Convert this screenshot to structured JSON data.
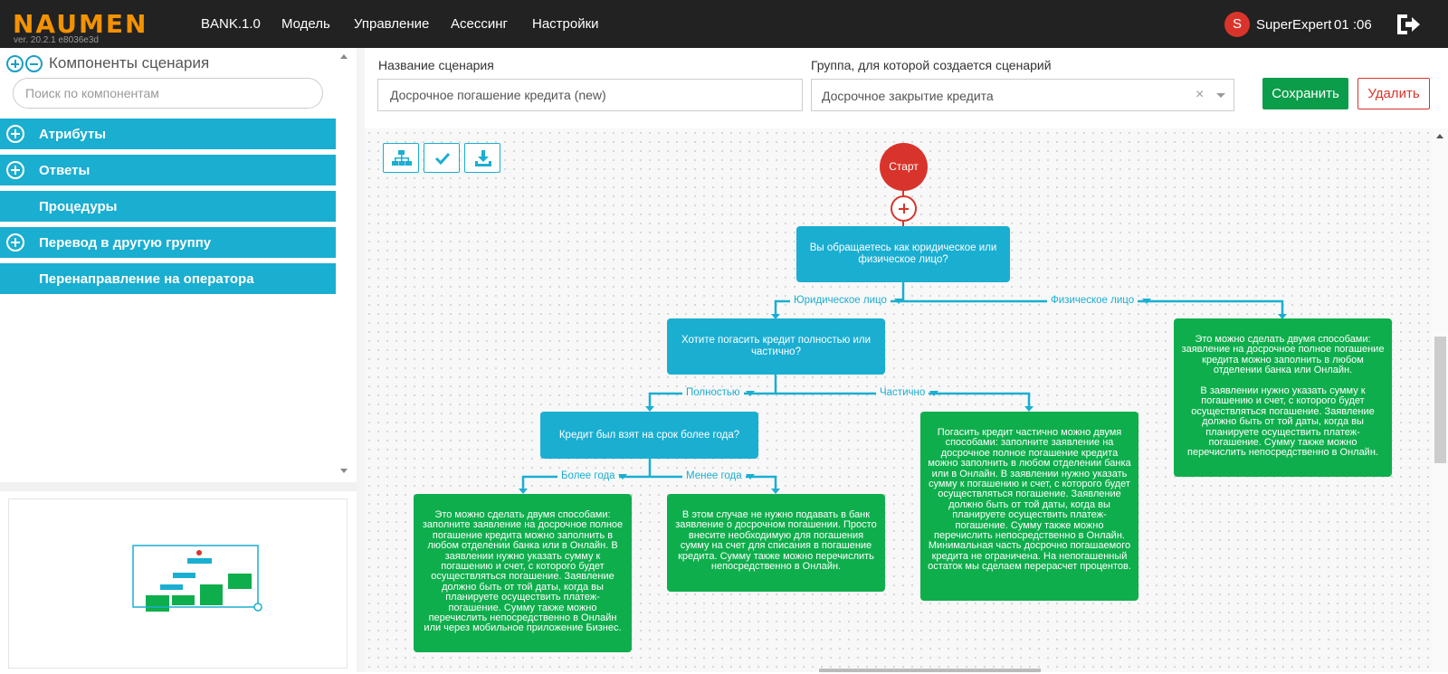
{
  "header": {
    "logo": "NAUMEN",
    "version": "ver. 20.2.1 e8036e3d",
    "nav": [
      "BANK.1.0",
      "Модель",
      "Управление",
      "Асессинг",
      "Настройки"
    ],
    "avatar_letter": "S",
    "username": "SuperExpert",
    "clock": "01 :06",
    "logout_icon": "logout-icon"
  },
  "components": {
    "title": "Компоненты сценария",
    "search_placeholder": "Поиск по компонентам",
    "items": [
      "Атрибуты",
      "Ответы",
      "Процедуры",
      "Перевод в другую группу",
      "Перенаправление на оператора"
    ]
  },
  "form": {
    "name_label": "Название сценария",
    "name_value": "Досрочное погашение кредита (new)",
    "group_label": "Группа, для которой создается сценарий",
    "group_value": "Досрочное закрытие кредита",
    "clear_glyph": "×",
    "save_label": "Сохранить",
    "delete_label": "Удалить"
  },
  "toolbar": {
    "icons": [
      "hierarchy-icon",
      "check-icon",
      "download-icon"
    ]
  },
  "diagram": {
    "start_label": "Старт",
    "q1": "Вы обращаетесь как юридическое или физическое лицо?",
    "q2": "Хотите погасить кредит полностью или частично?",
    "q3": "Кредит был взят на срок более года?",
    "edges": {
      "legal": "Юридическое лицо",
      "physical": "Физическое лицо",
      "full": "Полностью",
      "partial": "Частично",
      "more_year": "Более года",
      "less_year": "Менее года"
    },
    "answers": {
      "physical": "Это можно сделать двумя способами: заявление на досрочное полное погашение кредита можно заполнить в любом отделении банка или Онлайн.\n\nВ заявлении нужно указать сумму к погашению и счет, с которого будет осуществляться погашение. Заявление должно быть от той даты, когда вы планируете осуществить платеж-погашение. Сумму также можно перечислить непосредственно в Онлайн.",
      "partial": "Погасить кредит частично можно двумя способами: заполните заявление на досрочное полное погашение кредита можно заполнить в любом отделении банка или в Онлайн. В заявлении нужно указать сумму к погашению и счет, с которого будет осуществляться погашение. Заявление должно быть от той даты, когда вы планируете осуществить платеж-погашение. Сумму также можно перечислить непосредственно в Онлайн. Минимальная часть досрочно погашаемого кредита не ограничена. На непогашенный остаток мы сделаем перерасчет процентов.",
      "more_year": "Это можно сделать двумя способами: заполните заявление на досрочное полное погашение кредита можно заполнить в любом отделении банка или в Онлайн. В заявлении нужно указать сумму к погашению и счет, с которого будет осуществляться погашение. Заявление должно быть от той даты, когда вы планируете осуществить платеж-погашение. Сумму также можно перечислить непосредственно в Онлайн или через мобильное приложение Бизнес.",
      "less_year": "В этом случае не нужно подавать в банк заявление о досрочном погашении. Просто внесите необходимую для погашения сумму на счет для списания в погашение кредита. Сумму также можно перечислить непосредственно в Онлайн."
    }
  },
  "colors": {
    "accent": "#1aaed1",
    "answer": "#0fae4c",
    "start": "#d9342b",
    "logo": "#f39200",
    "save": "#0c9d4a"
  }
}
